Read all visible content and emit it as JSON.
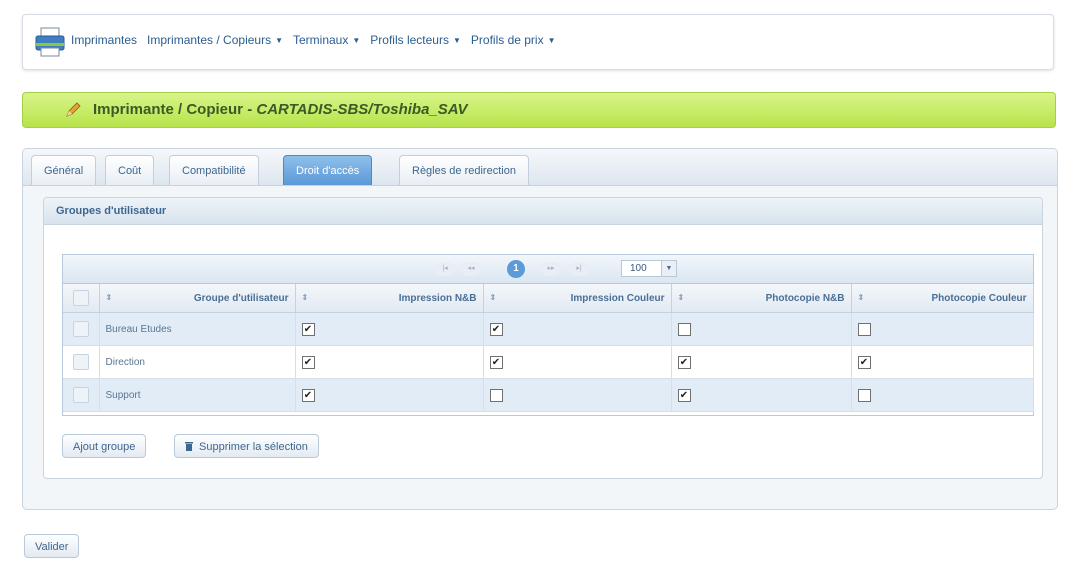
{
  "nav": {
    "items": [
      {
        "label": "Imprimantes",
        "caret": false
      },
      {
        "label": "Imprimantes / Copieurs",
        "caret": true
      },
      {
        "label": "Terminaux",
        "caret": true
      },
      {
        "label": "Profils lecteurs",
        "caret": true
      },
      {
        "label": "Profils de prix",
        "caret": true
      }
    ],
    "caret_glyph": "▼"
  },
  "title": {
    "main": "Imprimante / Copieur - ",
    "sub": "CARTADIS-SBS/Toshiba_SAV"
  },
  "tabs": [
    {
      "label": "Général",
      "active": false
    },
    {
      "label": "Coût",
      "active": false
    },
    {
      "label": "Compatibilité",
      "active": false
    },
    {
      "label": "Droit d'accès",
      "active": true
    },
    {
      "label": "Règles de redirection",
      "active": false
    }
  ],
  "groups": {
    "heading": "Groupes d'utilisateur",
    "pager": {
      "current_page": "1",
      "page_size": "100"
    },
    "columns": [
      "Groupe d'utilisateur",
      "Impression N&B",
      "Impression Couleur",
      "Photocopie N&B",
      "Photocopie Couleur"
    ],
    "rows": [
      {
        "name": "Bureau Etudes",
        "impression_nb": true,
        "impression_couleur": true,
        "photocopie_nb": false,
        "photocopie_couleur": false
      },
      {
        "name": "Direction",
        "impression_nb": true,
        "impression_couleur": true,
        "photocopie_nb": true,
        "photocopie_couleur": true
      },
      {
        "name": "Support",
        "impression_nb": true,
        "impression_couleur": false,
        "photocopie_nb": true,
        "photocopie_couleur": false
      }
    ],
    "add_button": "Ajout groupe",
    "delete_button": "Supprimer la sélection"
  },
  "validate_button": "Valider",
  "colors": {
    "accent": "#5b9bd8",
    "title_bar": "#c8ec6a",
    "link": "#2a5d92"
  }
}
